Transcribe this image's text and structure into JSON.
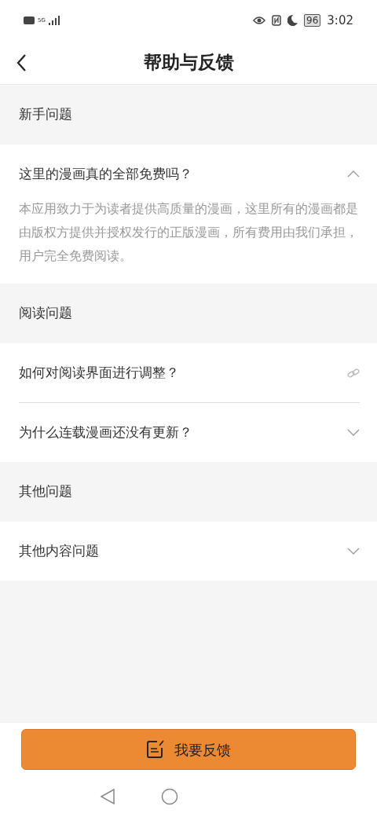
{
  "status_bar": {
    "network": "5G",
    "battery": "96",
    "time": "3:02"
  },
  "header": {
    "title": "帮助与反馈"
  },
  "sections": [
    {
      "title": "新手问题",
      "items": [
        {
          "kind": "toggle",
          "question": "这里的漫画真的全部免费吗？",
          "expanded": true,
          "answer": "本应用致力于为读者提供高质量的漫画，这里所有的漫画都是由版权方提供并授权发行的正版漫画，所有费用由我们承担，用户完全免费阅读。"
        }
      ]
    },
    {
      "title": "阅读问题",
      "items": [
        {
          "kind": "link",
          "question": "如何对阅读界面进行调整？"
        },
        {
          "kind": "toggle",
          "question": "为什么连载漫画还没有更新？",
          "expanded": false
        }
      ]
    },
    {
      "title": "其他问题",
      "items": [
        {
          "kind": "toggle",
          "question": "其他内容问题",
          "expanded": false
        }
      ]
    }
  ],
  "feedback_button": {
    "label": "我要反馈"
  }
}
